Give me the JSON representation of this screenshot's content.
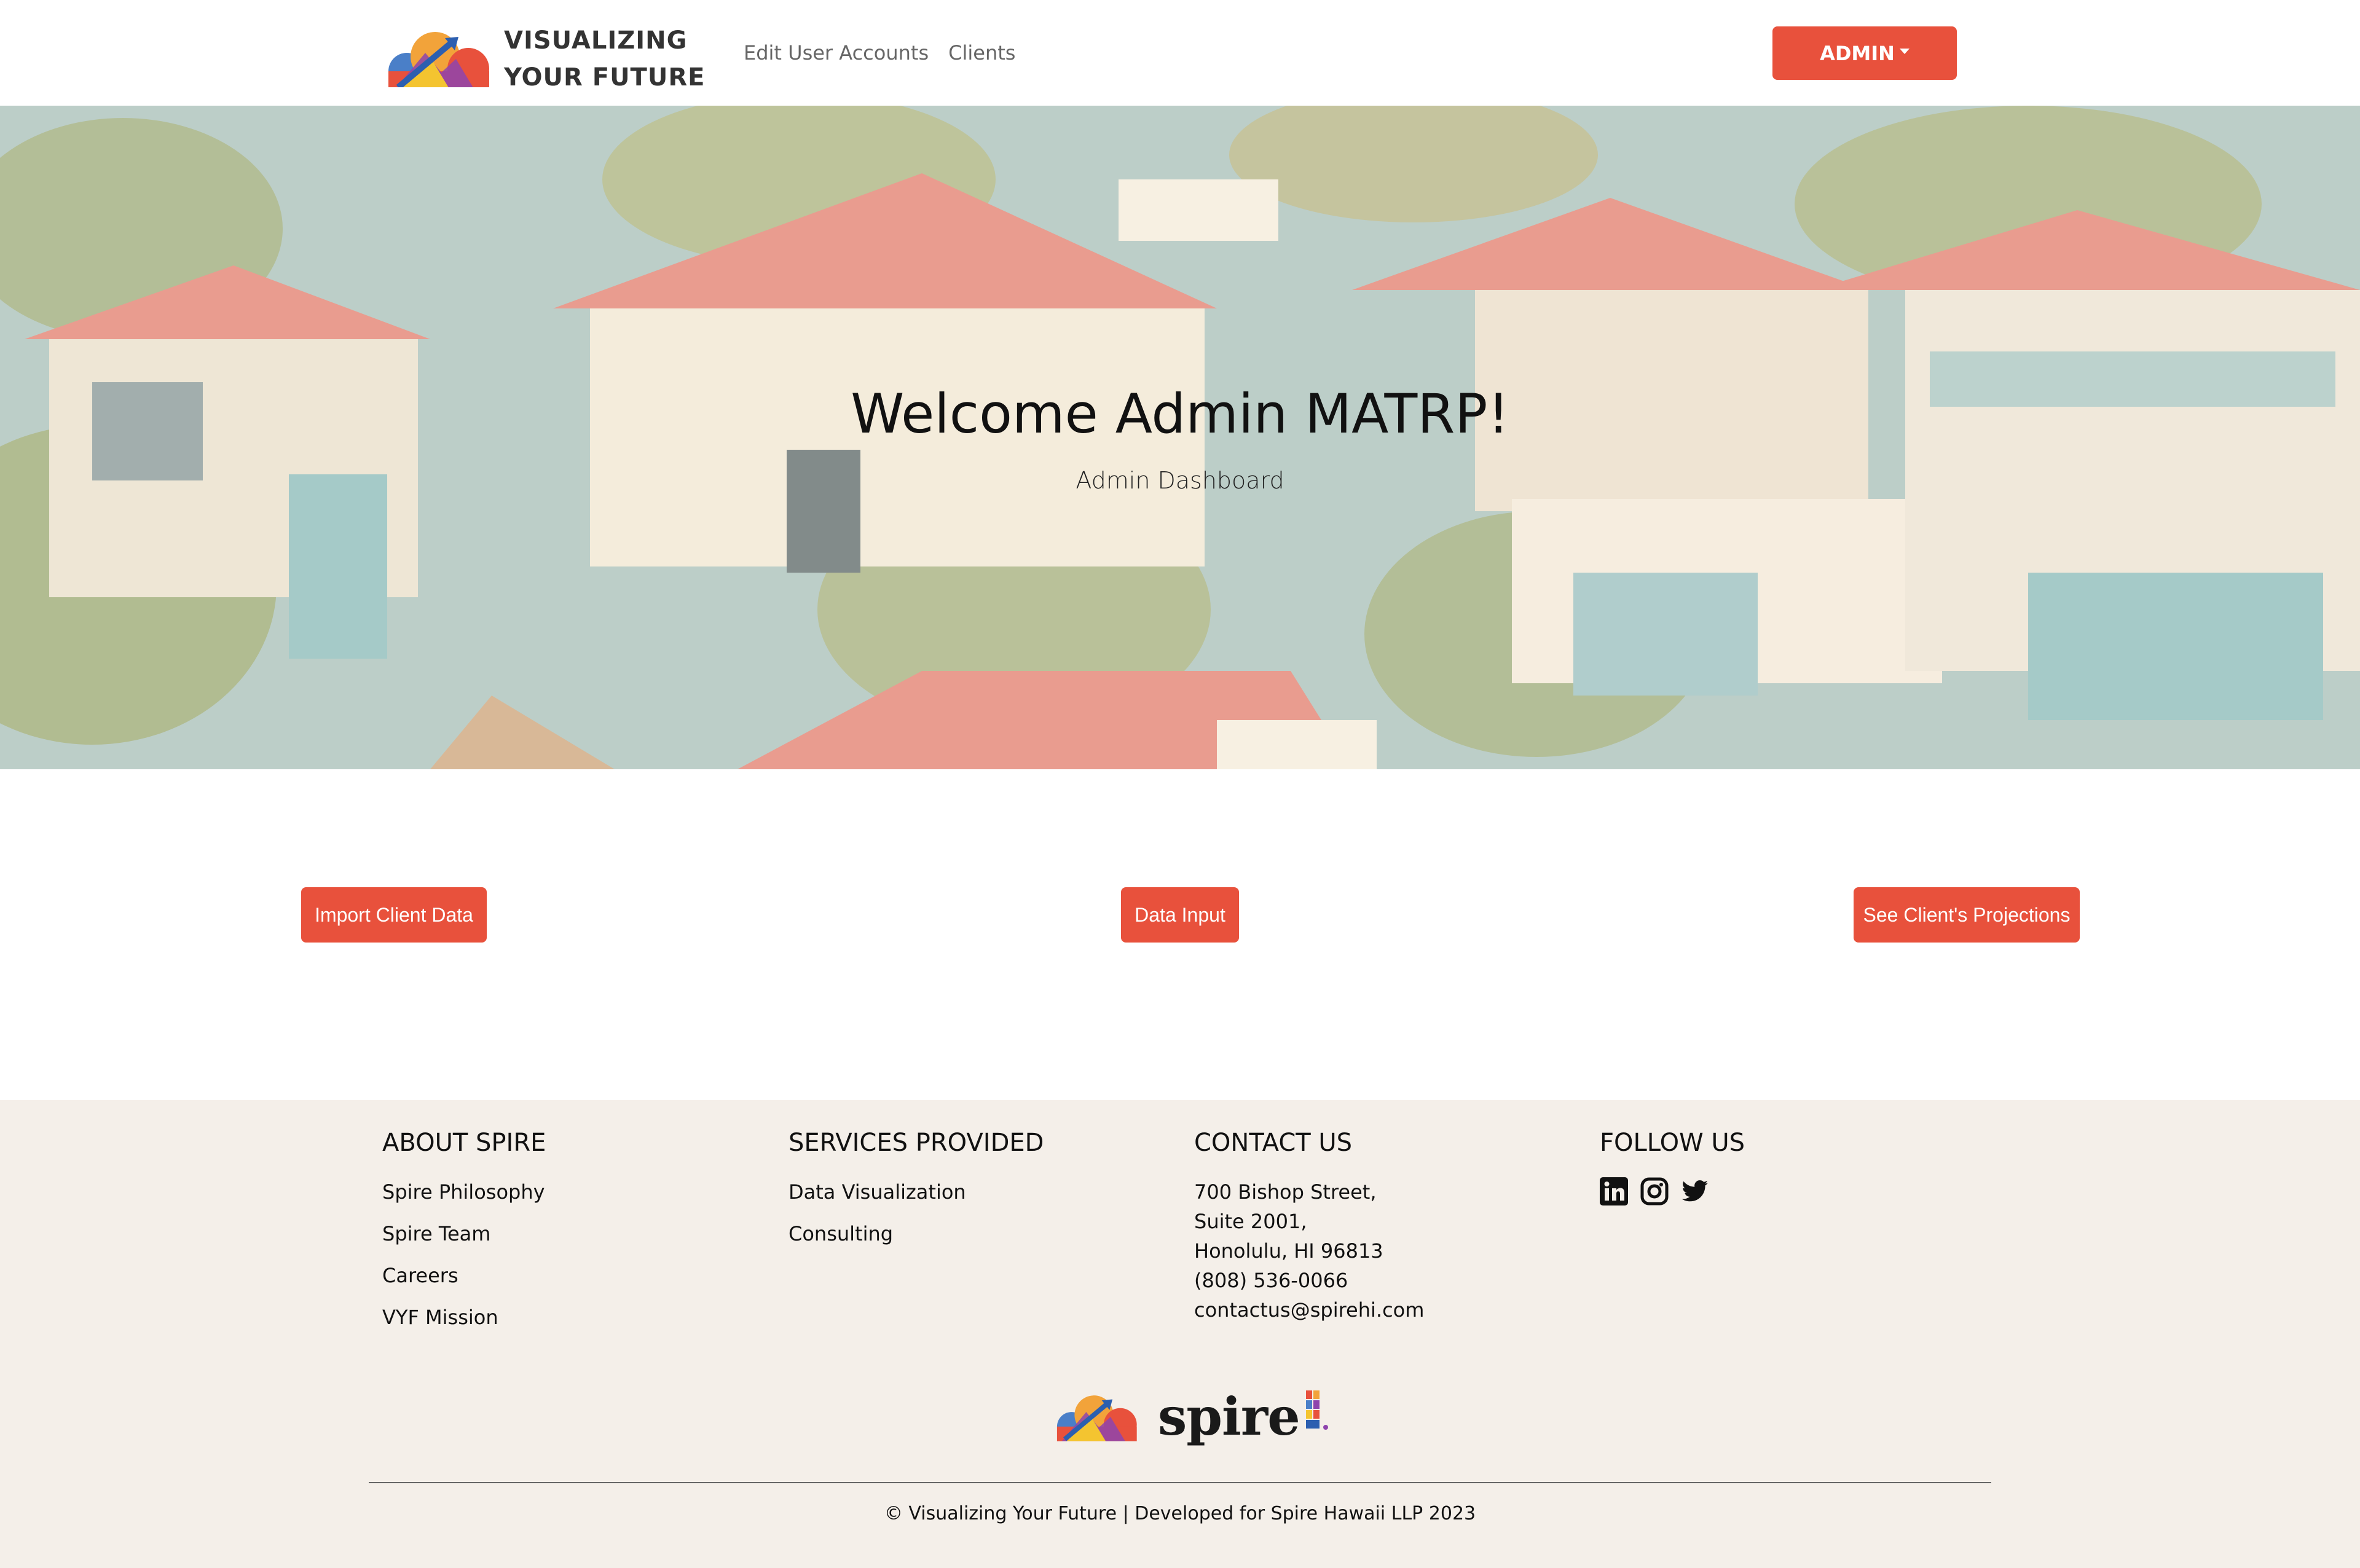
{
  "navbar": {
    "brand_line1": "VISUALIZING",
    "brand_line2": "YOUR FUTURE",
    "links": [
      "Edit User Accounts",
      "Clients"
    ],
    "admin_label": "ADMIN"
  },
  "hero": {
    "title": "Welcome Admin MATRP!",
    "subtitle": "Admin Dashboard"
  },
  "actions": {
    "import_label": "Import Client Data",
    "input_label": "Data Input",
    "projections_label": "See Client's Projections"
  },
  "footer": {
    "about": {
      "heading": "ABOUT SPIRE",
      "links": [
        "Spire Philosophy",
        "Spire Team",
        "Careers",
        "VYF Mission"
      ]
    },
    "services": {
      "heading": "SERVICES PROVIDED",
      "links": [
        "Data Visualization",
        "Consulting"
      ]
    },
    "contact": {
      "heading": "CONTACT US",
      "lines": [
        "700 Bishop Street,",
        "Suite 2001,",
        "Honolulu, HI 96813",
        "(808) 536-0066",
        "contactus@spirehi.com"
      ]
    },
    "follow": {
      "heading": "FOLLOW US",
      "icons": [
        "linkedin-icon",
        "instagram-icon",
        "twitter-icon"
      ]
    },
    "spire_wordmark": "spire",
    "copyright": "© Visualizing Your Future | Developed for Spire Hawaii LLP 2023"
  },
  "colors": {
    "accent": "#e8513c",
    "footer_bg": "#f4efe9",
    "text": "#111111"
  }
}
